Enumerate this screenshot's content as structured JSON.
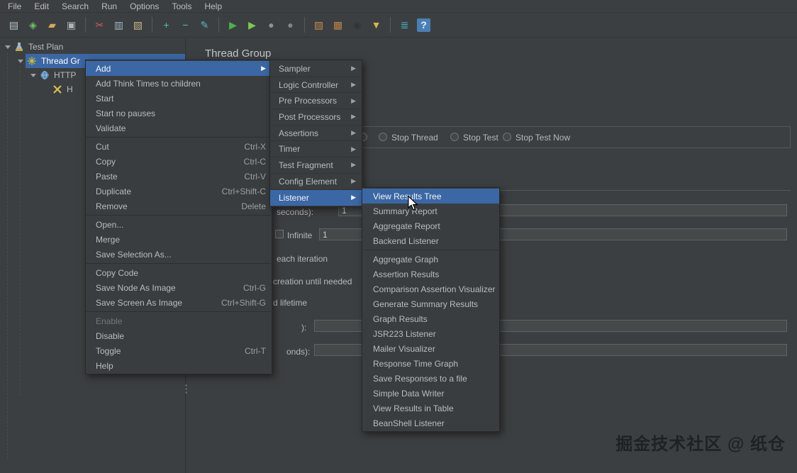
{
  "menubar": {
    "items": [
      "File",
      "Edit",
      "Search",
      "Run",
      "Options",
      "Tools",
      "Help"
    ]
  },
  "toolbar": {
    "icons": [
      {
        "name": "new-icon",
        "glyph": "▤",
        "color": "#b9c7ce"
      },
      {
        "name": "templates-icon",
        "glyph": "◈",
        "color": "#6cc06c"
      },
      {
        "name": "open-icon",
        "glyph": "▰",
        "color": "#d2aa5a"
      },
      {
        "name": "save-icon",
        "glyph": "▣",
        "color": "#aab4ba",
        "sep_after": true
      },
      {
        "name": "cut-icon",
        "glyph": "✂",
        "color": "#d65a5a"
      },
      {
        "name": "copy-icon",
        "glyph": "▥",
        "color": "#9fb3c4"
      },
      {
        "name": "paste-icon",
        "glyph": "▧",
        "color": "#c9b089",
        "sep_after": true
      },
      {
        "name": "expand-all-icon",
        "glyph": "+",
        "color": "#4ec1b2"
      },
      {
        "name": "collapse-all-icon",
        "glyph": "−",
        "color": "#4ec1b2"
      },
      {
        "name": "toggle-icon",
        "glyph": "✎",
        "color": "#53b8c8",
        "sep_after": true
      },
      {
        "name": "start-icon",
        "glyph": "▶",
        "color": "#4db14d"
      },
      {
        "name": "start-no-pauses-icon",
        "glyph": "▶",
        "color": "#7dc855"
      },
      {
        "name": "stop-icon",
        "glyph": "●",
        "color": "#8b9298"
      },
      {
        "name": "shutdown-icon",
        "glyph": "●",
        "color": "#7e868c",
        "sep_after": true
      },
      {
        "name": "clear-icon",
        "glyph": "▨",
        "color": "#c08a4e"
      },
      {
        "name": "clear-all-icon",
        "glyph": "▩",
        "color": "#b5824a"
      },
      {
        "name": "search-icon",
        "glyph": "◉",
        "color": "#2f3537"
      },
      {
        "name": "search-reset-icon",
        "glyph": "▼",
        "color": "#d8b54a",
        "sep_after": true
      },
      {
        "name": "function-helper-icon",
        "glyph": "≣",
        "color": "#4ab8c6"
      },
      {
        "name": "help-icon",
        "glyph": "?",
        "color": "#eaf2f8"
      }
    ]
  },
  "tree": {
    "items": [
      {
        "label": "Test Plan",
        "icon": "test-plan-icon",
        "expanded": true,
        "indent": 0
      },
      {
        "label": "Thread Gr",
        "icon": "thread-group-icon",
        "expanded": true,
        "indent": 1,
        "selected": true
      },
      {
        "label": "HTTP",
        "icon": "http-request-icon",
        "expanded": true,
        "indent": 2
      },
      {
        "label": "H",
        "icon": "disabled-element-icon",
        "expanded": false,
        "indent": 3
      }
    ]
  },
  "main": {
    "title": "Thread Group",
    "radio_labels": [
      "Stop Thread",
      "Stop Test",
      "Stop Test Now"
    ],
    "fragments": {
      "ramp_label": "seconds):",
      "ramp_value": "1",
      "infinite_label": "Infinite",
      "loop_value": "1",
      "same_user_label": "each iteration",
      "delay_label": "creation until needed",
      "lifetime_label": "d lifetime",
      "duration_label": "):",
      "startup_label": "onds):"
    }
  },
  "context_menu": {
    "items": [
      {
        "label": "Add",
        "submenu": true,
        "highlighted": true
      },
      {
        "label": "Add Think Times to children"
      },
      {
        "label": "Start"
      },
      {
        "label": "Start no pauses"
      },
      {
        "label": "Validate"
      },
      {
        "separator": true
      },
      {
        "label": "Cut",
        "shortcut": "Ctrl-X"
      },
      {
        "label": "Copy",
        "shortcut": "Ctrl-C"
      },
      {
        "label": "Paste",
        "shortcut": "Ctrl-V"
      },
      {
        "label": "Duplicate",
        "shortcut": "Ctrl+Shift-C"
      },
      {
        "label": "Remove",
        "shortcut": "Delete"
      },
      {
        "separator": true
      },
      {
        "label": "Open..."
      },
      {
        "label": "Merge"
      },
      {
        "label": "Save Selection As..."
      },
      {
        "separator": true
      },
      {
        "label": "Copy Code"
      },
      {
        "label": "Save Node As Image",
        "shortcut": "Ctrl-G"
      },
      {
        "label": "Save Screen As Image",
        "shortcut": "Ctrl+Shift-G"
      },
      {
        "separator": true
      },
      {
        "label": "Enable",
        "disabled": true
      },
      {
        "label": "Disable"
      },
      {
        "label": "Toggle",
        "shortcut": "Ctrl-T"
      },
      {
        "label": "Help"
      }
    ]
  },
  "add_submenu": {
    "items": [
      {
        "label": "Sampler",
        "submenu": true
      },
      {
        "label": "Logic Controller",
        "submenu": true
      },
      {
        "label": "Pre Processors",
        "submenu": true
      },
      {
        "label": "Post Processors",
        "submenu": true
      },
      {
        "label": "Assertions",
        "submenu": true
      },
      {
        "label": "Timer",
        "submenu": true
      },
      {
        "label": "Test Fragment",
        "submenu": true
      },
      {
        "label": "Config Element",
        "submenu": true
      },
      {
        "label": "Listener",
        "submenu": true,
        "highlighted": true
      }
    ]
  },
  "listener_submenu": {
    "items": [
      {
        "label": "View Results Tree",
        "highlighted": true
      },
      {
        "label": "Summary Report"
      },
      {
        "label": "Aggregate Report"
      },
      {
        "label": "Backend Listener"
      },
      {
        "separator": true
      },
      {
        "label": "Aggregate Graph"
      },
      {
        "label": "Assertion Results"
      },
      {
        "label": "Comparison Assertion Visualizer"
      },
      {
        "label": "Generate Summary Results"
      },
      {
        "label": "Graph Results"
      },
      {
        "label": "JSR223 Listener"
      },
      {
        "label": "Mailer Visualizer"
      },
      {
        "label": "Response Time Graph"
      },
      {
        "label": "Save Responses to a file"
      },
      {
        "label": "Simple Data Writer"
      },
      {
        "label": "View Results in Table"
      },
      {
        "label": "BeanShell Listener"
      }
    ]
  },
  "watermark": "掘金技术社区 @ 纸仓"
}
